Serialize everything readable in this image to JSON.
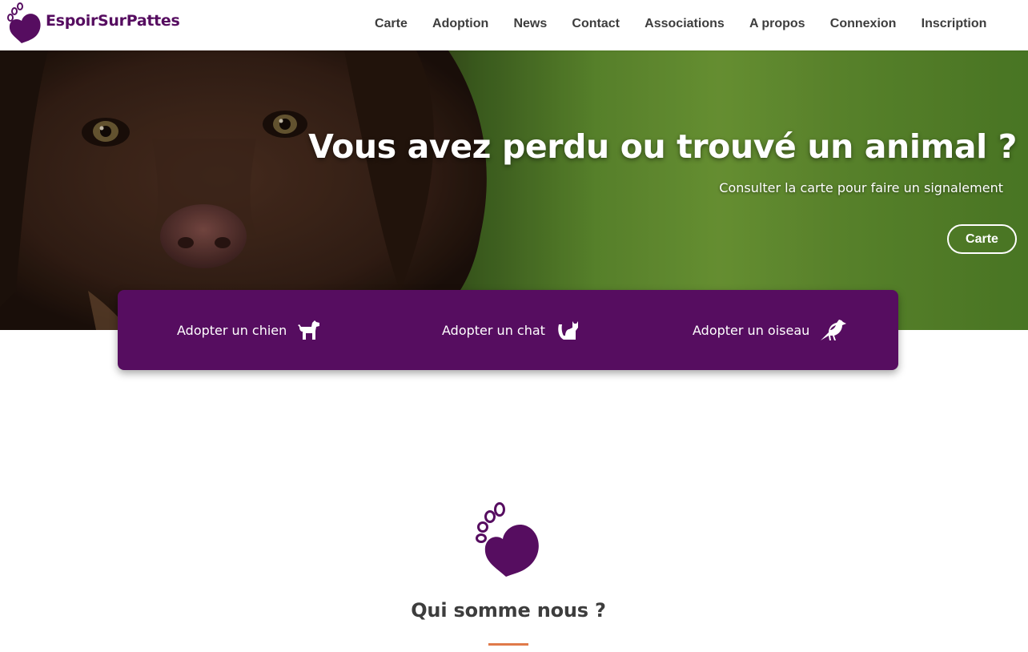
{
  "brand": {
    "name": "EspoirSurPattes",
    "color": "#560d60",
    "logo_icon": "paw-heart-icon"
  },
  "nav": {
    "items": [
      {
        "label": "Carte"
      },
      {
        "label": "Adoption"
      },
      {
        "label": "News"
      },
      {
        "label": "Contact"
      },
      {
        "label": "Associations"
      },
      {
        "label": "A propos"
      },
      {
        "label": "Connexion"
      },
      {
        "label": "Inscription"
      }
    ]
  },
  "hero": {
    "title": "Vous avez perdu ou trouvé un animal ?",
    "subtitle": "Consulter la carte pour faire un signalement",
    "button_label": "Carte"
  },
  "adopt": {
    "background": "#560d60",
    "items": [
      {
        "label": "Adopter un chien",
        "icon": "dog-icon"
      },
      {
        "label": "Adopter un chat",
        "icon": "cat-icon"
      },
      {
        "label": "Adopter un oiseau",
        "icon": "bird-icon"
      }
    ]
  },
  "about": {
    "title": "Qui somme nous ?",
    "logo_icon": "paw-heart-icon",
    "accent": "#e07a4a"
  }
}
